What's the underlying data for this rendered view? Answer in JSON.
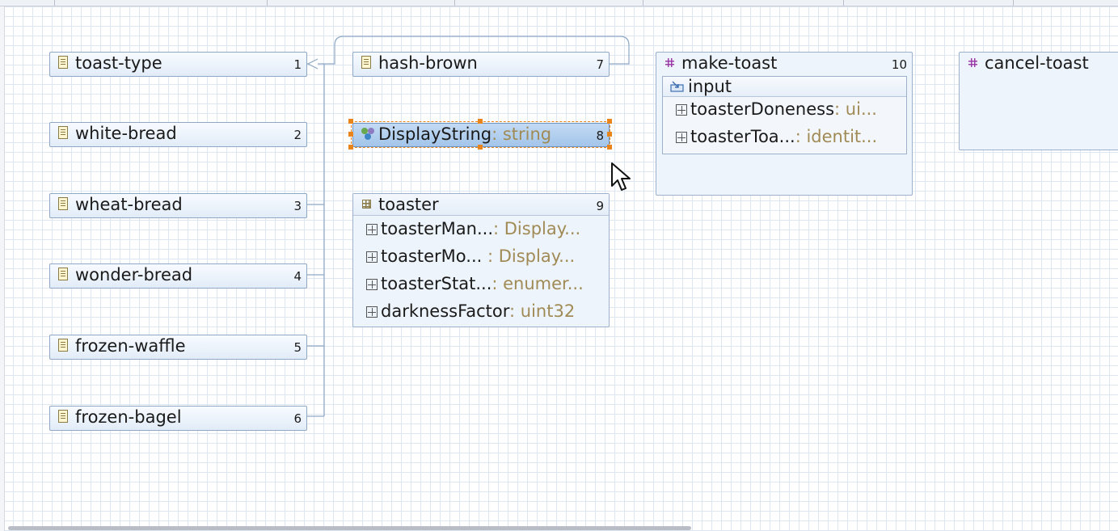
{
  "types": [
    {
      "label": "toast-type",
      "num": "1"
    },
    {
      "label": "white-bread",
      "num": "2"
    },
    {
      "label": "wheat-bread",
      "num": "3"
    },
    {
      "label": "wonder-bread",
      "num": "4"
    },
    {
      "label": "frozen-waffle",
      "num": "5"
    },
    {
      "label": "frozen-bagel",
      "num": "6"
    },
    {
      "label": "hash-brown",
      "num": "7"
    }
  ],
  "typedef": {
    "name": "DisplayString",
    "type": ": string",
    "num": "8"
  },
  "container": {
    "title": "toaster",
    "num": "9",
    "fields": [
      {
        "name": "toasterMan...",
        "type": ": Display..."
      },
      {
        "name": "toasterMo...",
        "type": " : Display..."
      },
      {
        "name": "toasterStat...",
        "type": ": enumer..."
      },
      {
        "name": "darknessFactor",
        "type": ": uint32"
      }
    ]
  },
  "rpc_make": {
    "title": "make-toast",
    "num": "10",
    "input_label": "input",
    "fields": [
      {
        "name": "toasterDoneness",
        "type": ": ui..."
      },
      {
        "name": "toasterToa...",
        "type": ": identit..."
      }
    ]
  },
  "rpc_cancel": {
    "title": "cancel-toast"
  },
  "icons": {
    "identity": "document-icon",
    "typedef": "typedef-icon",
    "container": "container-icon",
    "rpc": "rpc-icon",
    "input": "input-icon",
    "leaf": "leaf-plus-icon",
    "cursor": "mouse-pointer-icon"
  },
  "colors": {
    "selection": "#e8841a",
    "type_text": "#a08a55",
    "grid": "#dde6f1",
    "node_border": "#8fa8c5"
  }
}
